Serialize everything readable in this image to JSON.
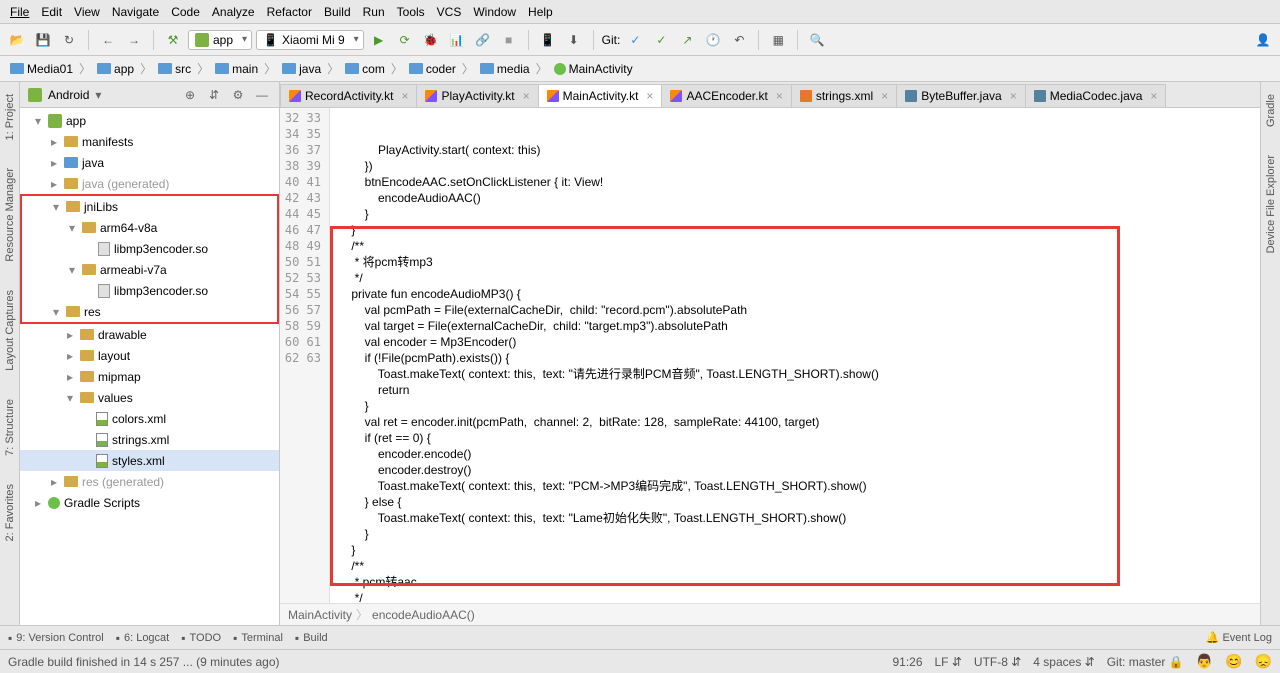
{
  "menu": {
    "items": [
      "File",
      "Edit",
      "View",
      "Navigate",
      "Code",
      "Analyze",
      "Refactor",
      "Build",
      "Run",
      "Tools",
      "VCS",
      "Window",
      "Help"
    ]
  },
  "toolbar": {
    "module": "app",
    "device": "Xiaomi Mi 9",
    "git": "Git:"
  },
  "breadcrumb": {
    "items": [
      "Media01",
      "app",
      "src",
      "main",
      "java",
      "com",
      "coder",
      "media",
      "MainActivity"
    ]
  },
  "sidebar": {
    "header": "Android",
    "tree": [
      {
        "l": "app",
        "d": 0,
        "i": "and",
        "tw": "▾",
        "hl": false
      },
      {
        "l": "manifests",
        "d": 1,
        "i": "folder",
        "tw": "▸",
        "hl": false
      },
      {
        "l": "java",
        "d": 1,
        "i": "folder blue",
        "tw": "▸",
        "hl": false
      },
      {
        "l": "java (generated)",
        "d": 1,
        "i": "folder",
        "tw": "▸",
        "hl": false,
        "gen": true
      },
      {
        "l": "jniLibs",
        "d": 1,
        "i": "folder",
        "tw": "▾",
        "hl": true
      },
      {
        "l": "arm64-v8a",
        "d": 2,
        "i": "folder",
        "tw": "▾",
        "hl": true
      },
      {
        "l": "libmp3encoder.so",
        "d": 3,
        "i": "so",
        "tw": "",
        "hl": true
      },
      {
        "l": "armeabi-v7a",
        "d": 2,
        "i": "folder",
        "tw": "▾",
        "hl": true
      },
      {
        "l": "libmp3encoder.so",
        "d": 3,
        "i": "so",
        "tw": "",
        "hl": true
      },
      {
        "l": "res",
        "d": 1,
        "i": "folder",
        "tw": "▾",
        "hl": true
      },
      {
        "l": "drawable",
        "d": 2,
        "i": "folder",
        "tw": "▸",
        "hl": false
      },
      {
        "l": "layout",
        "d": 2,
        "i": "folder",
        "tw": "▸",
        "hl": false
      },
      {
        "l": "mipmap",
        "d": 2,
        "i": "folder",
        "tw": "▸",
        "hl": false
      },
      {
        "l": "values",
        "d": 2,
        "i": "folder",
        "tw": "▾",
        "hl": false
      },
      {
        "l": "colors.xml",
        "d": 3,
        "i": "xml",
        "tw": "",
        "hl": false
      },
      {
        "l": "strings.xml",
        "d": 3,
        "i": "xml",
        "tw": "",
        "hl": false
      },
      {
        "l": "styles.xml",
        "d": 3,
        "i": "xml",
        "tw": "",
        "hl": false,
        "sel": true
      },
      {
        "l": "res (generated)",
        "d": 1,
        "i": "folder",
        "tw": "▸",
        "hl": false,
        "gen": true
      },
      {
        "l": "Gradle Scripts",
        "d": 0,
        "i": "dot",
        "tw": "▸",
        "hl": false
      }
    ]
  },
  "tabs": [
    {
      "l": "RecordActivity.kt",
      "i": "kt"
    },
    {
      "l": "PlayActivity.kt",
      "i": "kt"
    },
    {
      "l": "MainActivity.kt",
      "i": "kt",
      "active": true
    },
    {
      "l": "AACEncoder.kt",
      "i": "kt"
    },
    {
      "l": "strings.xml",
      "i": "xm"
    },
    {
      "l": "ByteBuffer.java",
      "i": "jv"
    },
    {
      "l": "MediaCodec.java",
      "i": "jv"
    }
  ],
  "gutter_start": 32,
  "gutter_end": 63,
  "code_lines": [
    {
      "t": "            PlayActivity.start( context: <kw>this</kw>)",
      "r": "            PlayActivity.start( <param>context:</param> <kw>this</kw>)"
    },
    {
      "r": "        })"
    },
    {
      "r": ""
    },
    {
      "r": "        btnEncodeAAC.setOnClickListener <kw>{</kw> <param>it: View!</param>"
    },
    {
      "r": "            encodeAudioAAC()"
    },
    {
      "r": "        <kw>}</kw>"
    },
    {
      "r": "    }"
    },
    {
      "r": ""
    },
    {
      "r": "    <cmt>/**</cmt>"
    },
    {
      "r": "    <cmt> * 将pcm转mp3</cmt>"
    },
    {
      "r": "    <cmt> */</cmt>"
    },
    {
      "r": "    <kw>private fun</kw> encodeAudioMP3() {"
    },
    {
      "r": "        <kw>val</kw> pcmPath = File(<purple>externalCacheDir</purple>,  <param>child:</param> <str>\"record.pcm\"</str>).<purple>absolutePath</purple>"
    },
    {
      "r": "        <kw>val</kw> target = File(<purple>externalCacheDir</purple>,  <param>child:</param> <str>\"target.mp3\"</str>).<purple>absolutePath</purple>"
    },
    {
      "r": "        <kw>val</kw> encoder = Mp3Encoder()"
    },
    {
      "r": "        <kw>if</kw> (!File(pcmPath).exists()) {"
    },
    {
      "r": "            Toast.makeText( <param>context:</param> <kw>this</kw>,  <param>text:</param> <str>\"请先进行录制PCM音频\"</str>, Toast.<purple>LENGTH_SHORT</purple>).show()"
    },
    {
      "r": "            <kw>return</kw>"
    },
    {
      "r": "        }"
    },
    {
      "r": "        <kw>val</kw> ret = encoder.init(pcmPath,  <param>channel:</param> <num>2</num>,  <param>bitRate:</param> <num>128</num>,  <param>sampleRate:</param> <num>44100</num>, target)"
    },
    {
      "r": "        <kw>if</kw> (ret == <num>0</num>) {"
    },
    {
      "r": "            encoder.encode()"
    },
    {
      "r": "            encoder.destroy()"
    },
    {
      "r": "            Toast.makeText( <param>context:</param> <kw>this</kw>,  <param>text:</param> <str>\"PCM->MP3编码完成\"</str>, Toast.<purple>LENGTH_SHORT</purple>).show()"
    },
    {
      "r": "        } <kw>else</kw> {"
    },
    {
      "r": "            Toast.makeText( <param>context:</param> <kw>this</kw>,  <param>text:</param> <str>\"Lame初始化失败\"</str>, Toast.<purple>LENGTH_SHORT</purple>).show()"
    },
    {
      "r": "        }"
    },
    {
      "r": "    }"
    },
    {
      "r": ""
    },
    {
      "r": "    <cmt>/**</cmt>"
    },
    {
      "r": "    <cmt> * pcm转aac</cmt>"
    },
    {
      "r": "    <cmt> */</cmt>"
    }
  ],
  "crumbs": [
    "MainActivity",
    "encodeAudioAAC()"
  ],
  "bottom": {
    "tabs": [
      "9: Version Control",
      "6: Logcat",
      "TODO",
      "Terminal",
      "Build"
    ],
    "event": "Event Log"
  },
  "status": {
    "msg": "Gradle build finished in 14 s 257 ... (9 minutes ago)",
    "pos": "91:26",
    "le": "LF",
    "enc": "UTF-8",
    "indent": "4 spaces",
    "git": "Git: master"
  },
  "rails": {
    "left": [
      "1: Project",
      "Resource Manager",
      "Layout Captures",
      "7: Structure",
      "2: Favorites"
    ],
    "right": [
      "Gradle",
      "Device File Explorer"
    ]
  }
}
